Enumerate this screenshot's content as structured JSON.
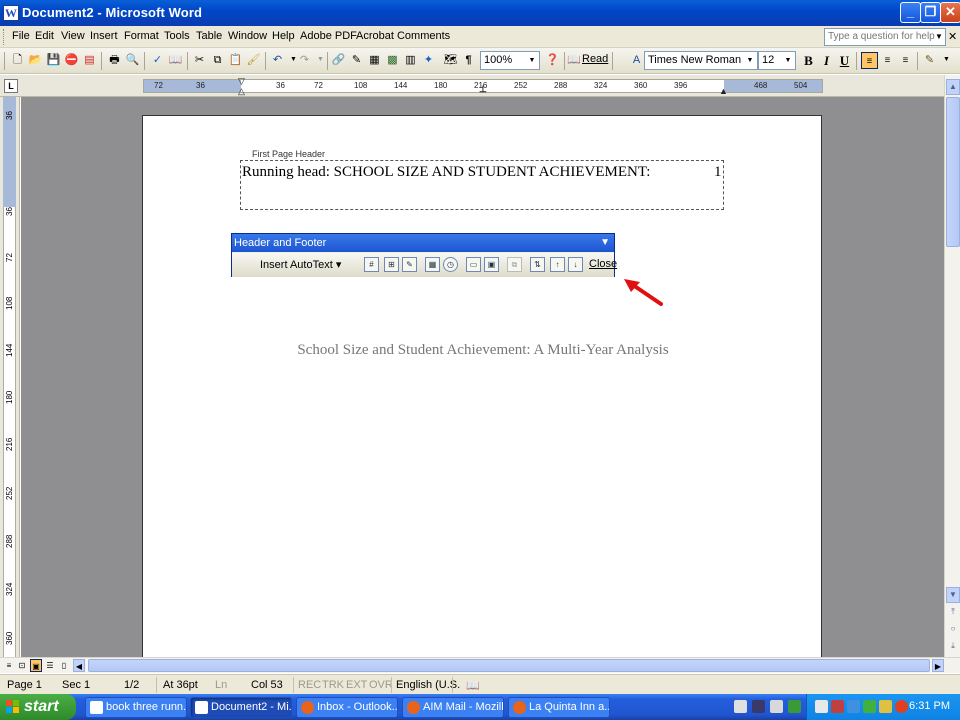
{
  "window": {
    "title": "Document2 - Microsoft Word",
    "app_icon": "W"
  },
  "menubar": {
    "items": [
      {
        "label": "File"
      },
      {
        "label": "Edit"
      },
      {
        "label": "View"
      },
      {
        "label": "Insert"
      },
      {
        "label": "Format"
      },
      {
        "label": "Tools"
      },
      {
        "label": "Table"
      },
      {
        "label": "Window"
      },
      {
        "label": "Help"
      },
      {
        "label": "Adobe PDF"
      },
      {
        "label": "Acrobat Comments"
      }
    ],
    "help_placeholder": "Type a question for help",
    "close_glyph": "✕"
  },
  "toolbar": {
    "zoom": "100%",
    "read_label": "Read",
    "font": "Times New Roman",
    "size": "12",
    "bold": "B",
    "italic": "I",
    "underline": "U"
  },
  "ruler": {
    "ticks": [
      "72",
      "36",
      "36",
      "72",
      "108",
      "144",
      "180",
      "216",
      "252",
      "288",
      "324",
      "360",
      "396",
      "468",
      "504"
    ],
    "vticks": [
      "36",
      "36",
      "72",
      "108",
      "144",
      "180",
      "216",
      "252",
      "288",
      "324",
      "360"
    ]
  },
  "document": {
    "header_label": "First Page Header",
    "header_text": "Running head: SCHOOL SIZE AND STUDENT ACHIEVEMENT:",
    "page_number": "1",
    "title": "School Size and Student Achievement: A Multi-Year Analysis"
  },
  "hf_toolbar": {
    "title": "Header and Footer",
    "insert_autotext": "Insert AutoText ▾",
    "close_label": "Close"
  },
  "status": {
    "page": "Page 1",
    "sec": "Sec 1",
    "pages": "1/2",
    "at": "At 36pt",
    "ln": "Ln",
    "col": "Col 53",
    "rec": "REC",
    "trk": "TRK",
    "ext": "EXT",
    "ovr": "OVR",
    "language": "English (U.S."
  },
  "taskbar": {
    "start_label": "start",
    "tasks": [
      {
        "label": "book three runn..."
      },
      {
        "label": "Document2 - Mi..."
      },
      {
        "label": "Inbox - Outlook..."
      },
      {
        "label": "AIM Mail - Mozilla..."
      },
      {
        "label": "La Quinta Inn a..."
      }
    ],
    "clock": "6:31 PM"
  },
  "colors": {
    "titlebar": "#0047c8",
    "taskbar": "#245edc",
    "start": "#3c9a36",
    "arrow": "#e01010"
  }
}
